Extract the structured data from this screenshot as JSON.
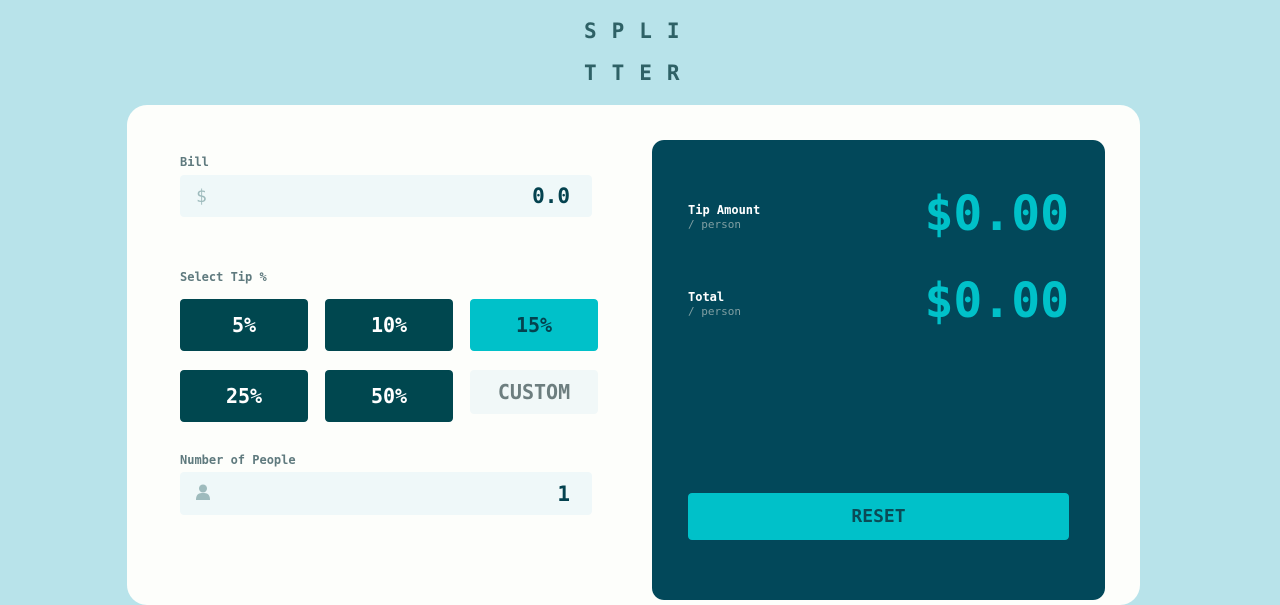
{
  "logo": {
    "line1": "SPLI",
    "line2": "TTER"
  },
  "bill": {
    "label": "Bill",
    "currency_icon": "$",
    "value": "0.0"
  },
  "tip": {
    "label": "Select Tip %",
    "options": [
      "5%",
      "10%",
      "15%",
      "25%",
      "50%"
    ],
    "active": "15%",
    "custom_placeholder": "CUSTOM"
  },
  "people": {
    "label": "Number of People",
    "icon": "person-icon",
    "value": "1"
  },
  "results": {
    "tip_amount": {
      "label": "Tip Amount",
      "sub": "/ person",
      "value": "$0.00"
    },
    "total": {
      "label": "Total",
      "sub": "/ person",
      "value": "$0.00"
    },
    "reset_label": "RESET"
  },
  "colors": {
    "background": "#b8e3ea",
    "panel": "#02485a",
    "accent": "#00c1c9",
    "button": "#00474f",
    "field": "#eff8f9"
  }
}
